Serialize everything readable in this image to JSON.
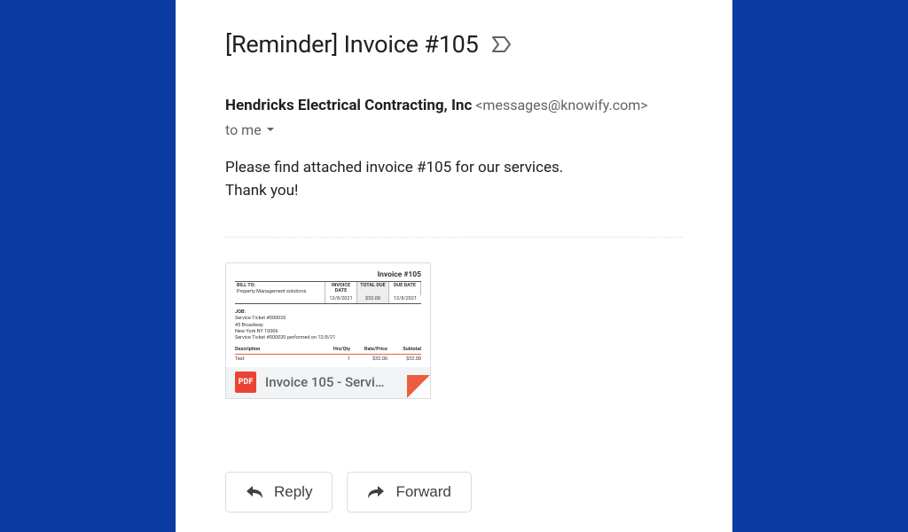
{
  "email": {
    "subject": "[Reminder] Invoice #105",
    "sender_name": "Hendricks Electrical Contracting, Inc",
    "sender_email": "<messages@knowify.com>",
    "to_line": "to me",
    "body_line1": "Please find attached invoice #105 for our services.",
    "body_line2": "Thank you!"
  },
  "attachment": {
    "badge": "PDF",
    "file_label": "Invoice 105 - Servi…",
    "preview": {
      "title": "Invoice #105",
      "billto_label": "BILL TO:",
      "billto_name": "Property Management solutions",
      "h1": "INVOICE DATE",
      "h2": "TOTAL DUE",
      "h3": "DUE DATE",
      "v1": "12/8/2021",
      "v2": "$32.00",
      "v3": "12/8/2021",
      "job_label": "JOB:",
      "job_l1": "Service Ticket #000020",
      "job_l2": "45 Broadway",
      "job_l3": "New York NY 10006",
      "job_l4": "Service Ticket #000020 performed on 12/8/21",
      "col_desc": "Description",
      "col_qty": "Hrs/Qty",
      "col_rate": "Rate/Price",
      "col_sub": "Subtotal",
      "item_desc": "Test",
      "item_qty": "1",
      "item_rate": "$32.00",
      "item_sub": "$32.00"
    }
  },
  "actions": {
    "reply": "Reply",
    "forward": "Forward"
  }
}
